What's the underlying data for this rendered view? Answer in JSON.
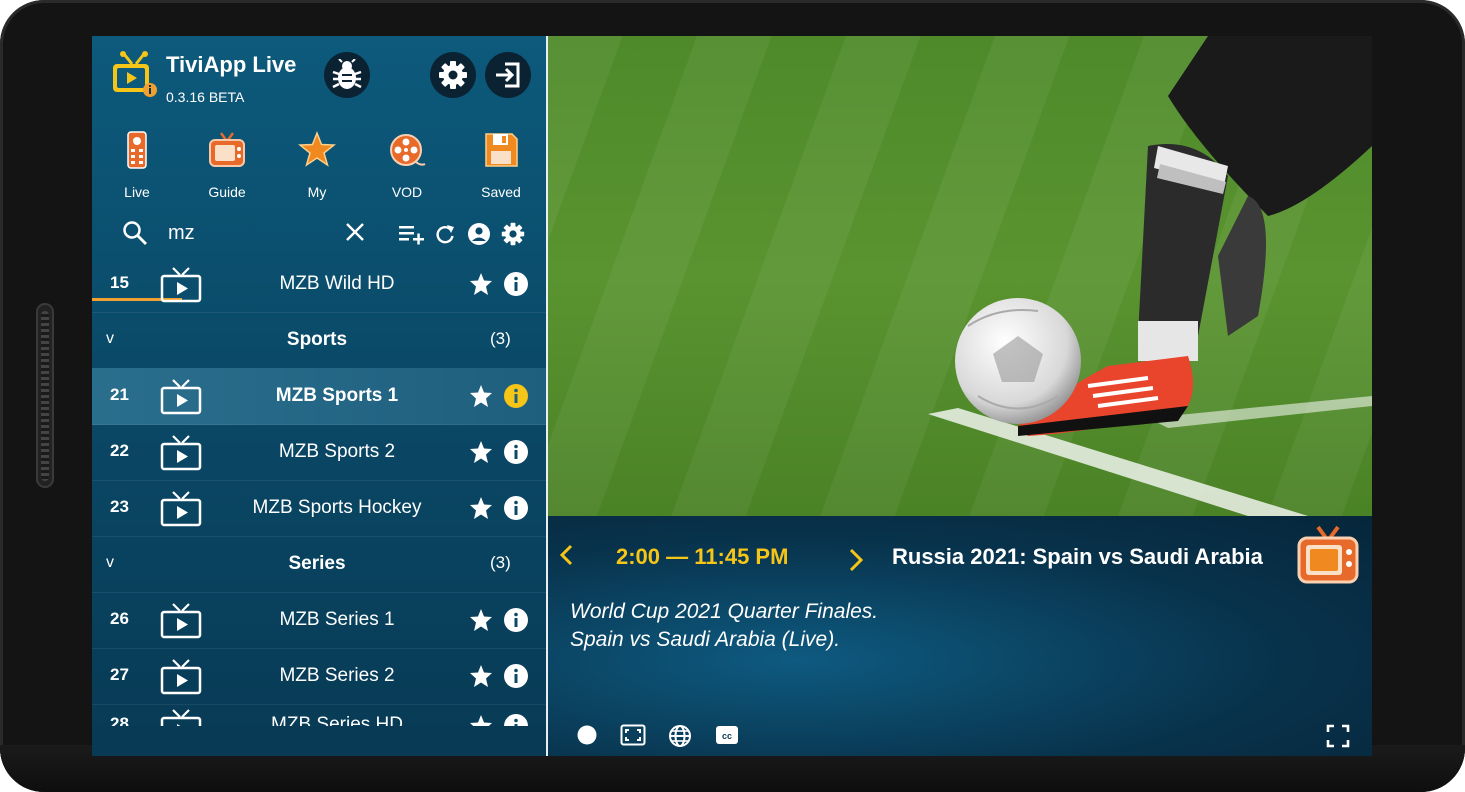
{
  "app": {
    "title": "TiviApp Live",
    "version": "0.3.16  BETA"
  },
  "nav": [
    {
      "label": "Live",
      "icon": "remote-icon"
    },
    {
      "label": "Guide",
      "icon": "tv-guide-icon"
    },
    {
      "label": "My",
      "icon": "star-icon"
    },
    {
      "label": "VOD",
      "icon": "film-reel-icon"
    },
    {
      "label": "Saved",
      "icon": "floppy-icon"
    }
  ],
  "search": {
    "value": "mz"
  },
  "list": {
    "r15": {
      "num": "15",
      "name": "MZB Wild HD"
    },
    "g_sports": {
      "name": "Sports",
      "count": "(3)",
      "chevron": "v"
    },
    "r21": {
      "num": "21",
      "name": "MZB Sports 1"
    },
    "r22": {
      "num": "22",
      "name": "MZB Sports 2"
    },
    "r23": {
      "num": "23",
      "name": "MZB Sports Hockey"
    },
    "g_series": {
      "name": "Series",
      "count": "(3)",
      "chevron": "v"
    },
    "r26": {
      "num": "26",
      "name": "MZB Series 1"
    },
    "r27": {
      "num": "27",
      "name": "MZB Series 2"
    },
    "r28": {
      "num": "28",
      "name": "MZB Series HD"
    }
  },
  "epg": {
    "time": "2:00 — 11:45 PM",
    "title": "Russia 2021: Spain vs Saudi Arabia",
    "desc_line1": "World Cup 2021 Quarter Finales.",
    "desc_line2": "Spain vs Saudi Arabia (Live)."
  },
  "colors": {
    "accent": "#f0a030",
    "time": "#f5c518",
    "sidebar": "#0d5a7c",
    "active_info": "#f5c518"
  }
}
